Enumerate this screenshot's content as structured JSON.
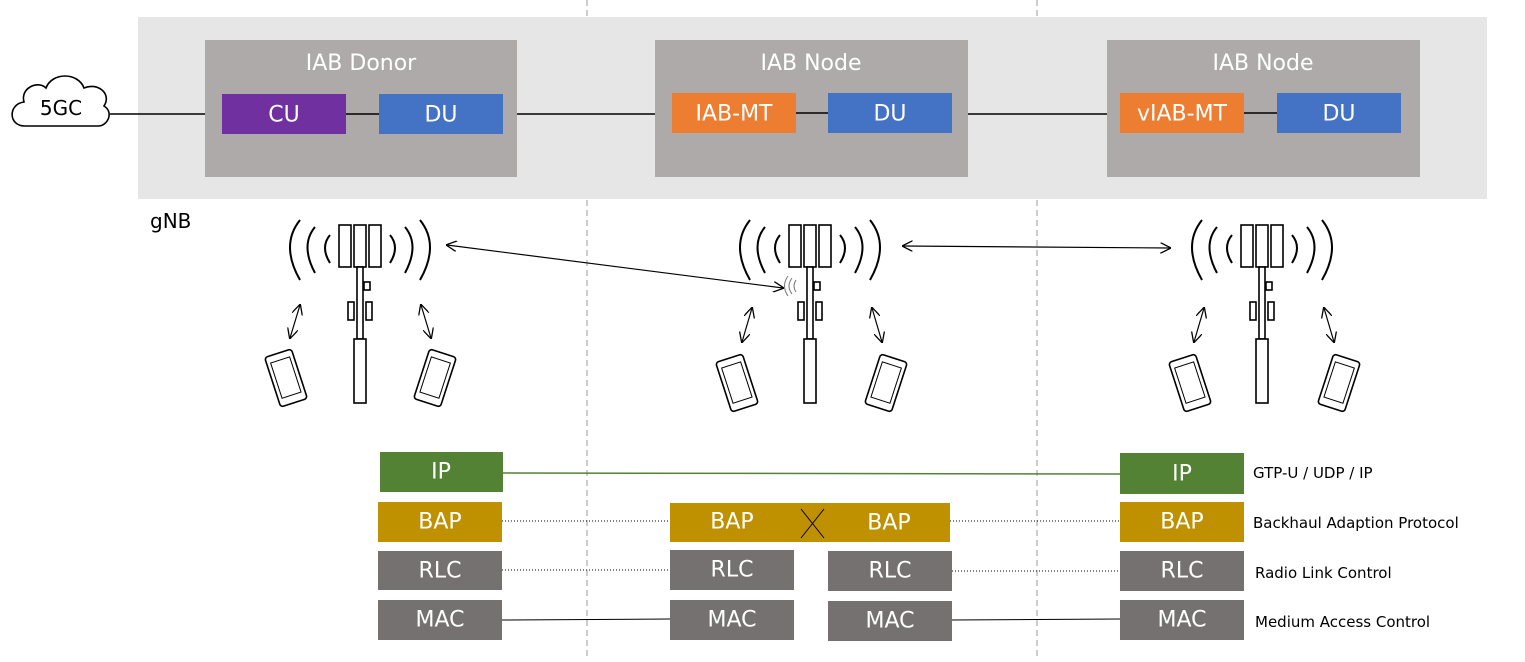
{
  "core": {
    "label": "5GC"
  },
  "gnb_label": "gNB",
  "nodes": [
    {
      "title": "IAB Donor",
      "left": "CU",
      "right": "DU"
    },
    {
      "title": "IAB Node",
      "left": "IAB-MT",
      "right": "DU"
    },
    {
      "title": "IAB Node",
      "left": "vIAB-MT",
      "right": "DU"
    }
  ],
  "stack": {
    "ip": "IP",
    "bap": "BAP",
    "rlc": "RLC",
    "mac": "MAC"
  },
  "legend": {
    "ip": "GTP-U / UDP / IP",
    "bap": "Backhaul Adaption Protocol",
    "rlc": "Radio Link Control",
    "mac": "Medium Access Control"
  },
  "colors": {
    "band": "#e7e6e6",
    "node_box": "#aeaaaa",
    "cu": "#7030a0",
    "du": "#4472c4",
    "mt": "#ed7d31",
    "ip": "#548235",
    "bap": "#bf9000",
    "rlc_mac": "#767171"
  }
}
